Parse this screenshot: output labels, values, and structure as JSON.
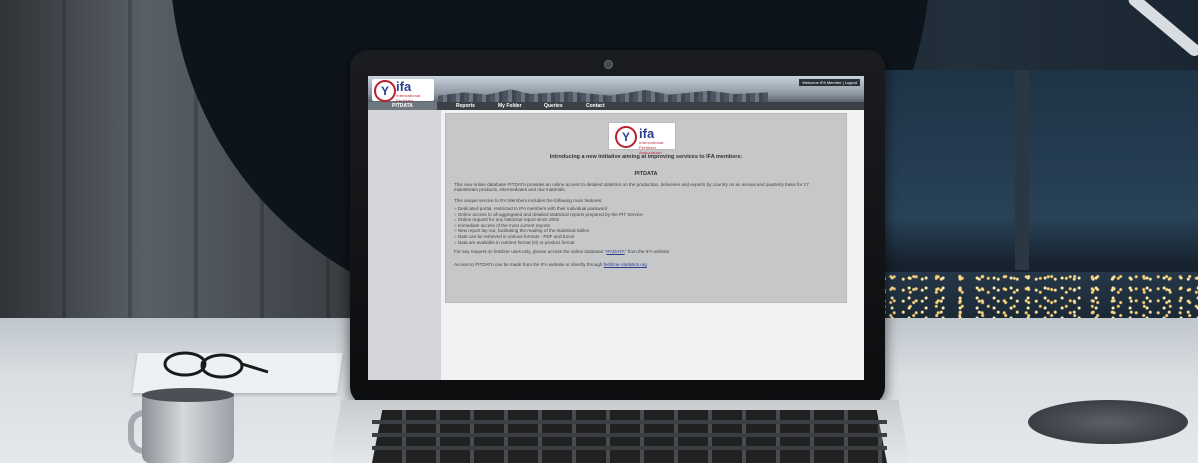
{
  "site": {
    "logo_text": "ifa",
    "logo_subtext": "International Fertilizer Association",
    "welcome": "Welcome IFA Member | Logout",
    "nav": {
      "active": "PITDATA",
      "items": [
        "Reports",
        "My Folder",
        "Queries",
        "Contact"
      ]
    }
  },
  "main": {
    "intro": "Introducing a new initiative aiming at improving services to IFA members:",
    "title": "PITDATA",
    "paragraph1": "This new online database PITDATA provides an online access to detailed statistics on the production, deliveries and exports by country on an annual and quarterly basis for 17 mainstream products, intermediates and raw materials.",
    "paragraph2": "This unique service to IFA Members includes the following main features:",
    "features": [
      "Dedicated portal, restricted to IFA members with their individual password",
      "Online access to all aggregated and detailed statistical reports prepared by the PIT Service",
      "Online request for any historical report since 2002",
      "Immediate access of the most current reports",
      "New report lay-out, facilitating the reading of the statistical tables",
      "Data can be retrieved in various formats - PDF and Excel",
      "Data are available in nutrient format (N) or product format"
    ],
    "paragraph3_prefix": "For any request on fertilizer uses only, please access the online database",
    "paragraph3_link": "IFADATA",
    "paragraph3_suffix": "from the IFA website",
    "paragraph4_prefix": "Access to PITDATA can be made from the IFA website or directly through",
    "paragraph4_link": "fertilizer-statistics.org"
  },
  "colors": {
    "brand_blue": "#2a3f8f",
    "brand_red": "#b8202b",
    "nav_bg": "#3a4046",
    "content_bg": "#c6c7c9"
  }
}
